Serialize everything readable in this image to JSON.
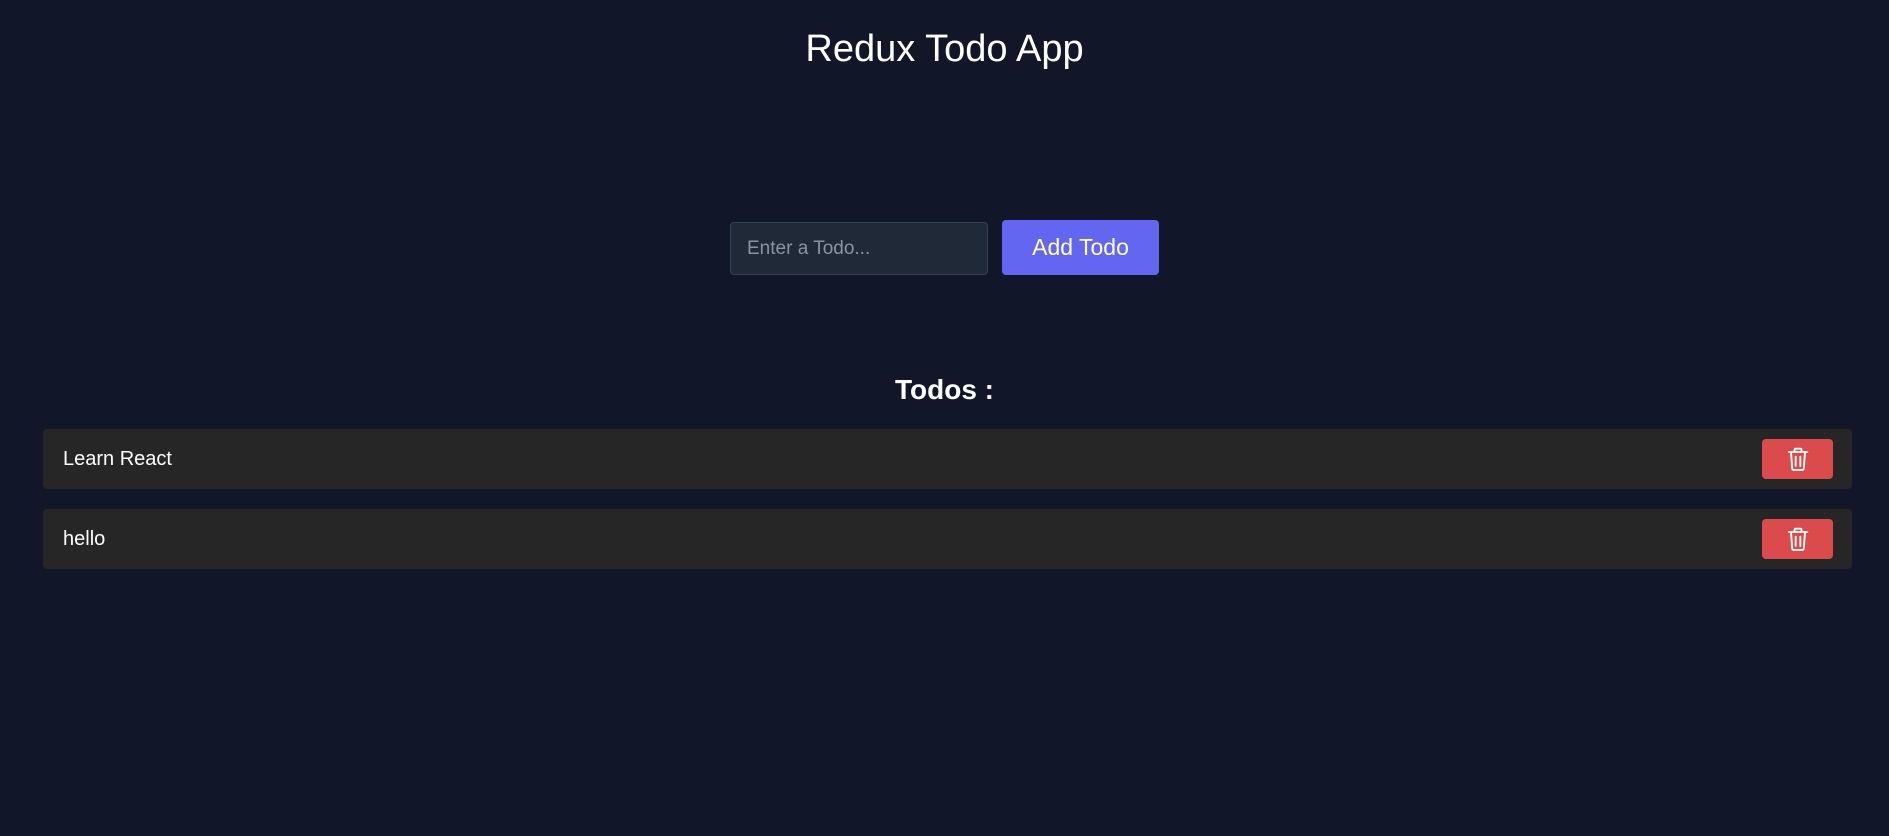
{
  "header": {
    "title": "Redux Todo App"
  },
  "add_form": {
    "input_value": "",
    "input_placeholder": "Enter a Todo...",
    "add_button_label": "Add Todo",
    "accent_color": "#6366f1"
  },
  "todos": {
    "heading": "Todos :",
    "items": [
      {
        "text": "Learn React",
        "delete_icon": "trash-icon"
      },
      {
        "text": "hello",
        "delete_icon": "trash-icon"
      }
    ],
    "delete_color": "#dc4b4b"
  },
  "colors": {
    "background": "#111729",
    "item_background": "#262626"
  }
}
